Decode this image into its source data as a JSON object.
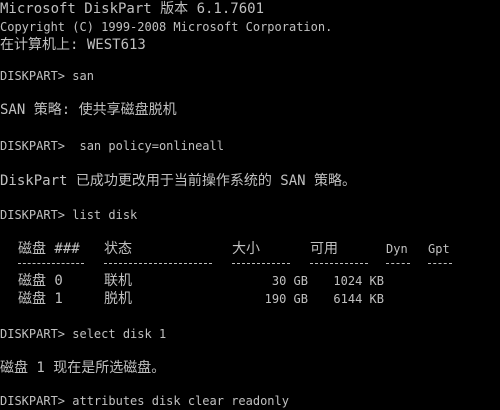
{
  "console": {
    "background": "#000000",
    "foreground": "#c0c0c0",
    "lines": {
      "header_1": "Microsoft DiskPart 版本 6.1.7601",
      "header_2": "Copyright (C) 1999-2008 Microsoft Corporation.",
      "header_3": "在计算机上: WEST613",
      "cmd_1": "DISKPART> san",
      "out_1": "SAN 策略: 使共享磁盘脱机",
      "cmd_2": "DISKPART>  san policy=onlineall",
      "out_2": "DiskPart 已成功更改用于当前操作系统的 SAN 策略。",
      "cmd_3": "DISKPART> list disk",
      "cmd_4": "DISKPART> select disk 1",
      "out_4": "磁盘 1 现在是所选磁盘。",
      "cmd_5": "DISKPART> attributes disk clear readonly"
    },
    "disk_table": {
      "headers": {
        "disk": "磁盘 ###",
        "status": "状态",
        "size": "大小",
        "free": "可用",
        "dyn": "Dyn",
        "gpt": "Gpt"
      },
      "rows": [
        {
          "disk": "磁盘 0",
          "status": "联机",
          "size": "30 GB",
          "free": "1024 KB",
          "dyn": "",
          "gpt": ""
        },
        {
          "disk": "磁盘 1",
          "status": "脱机",
          "size": "190 GB",
          "free": "6144 KB",
          "dyn": "",
          "gpt": ""
        }
      ]
    }
  }
}
